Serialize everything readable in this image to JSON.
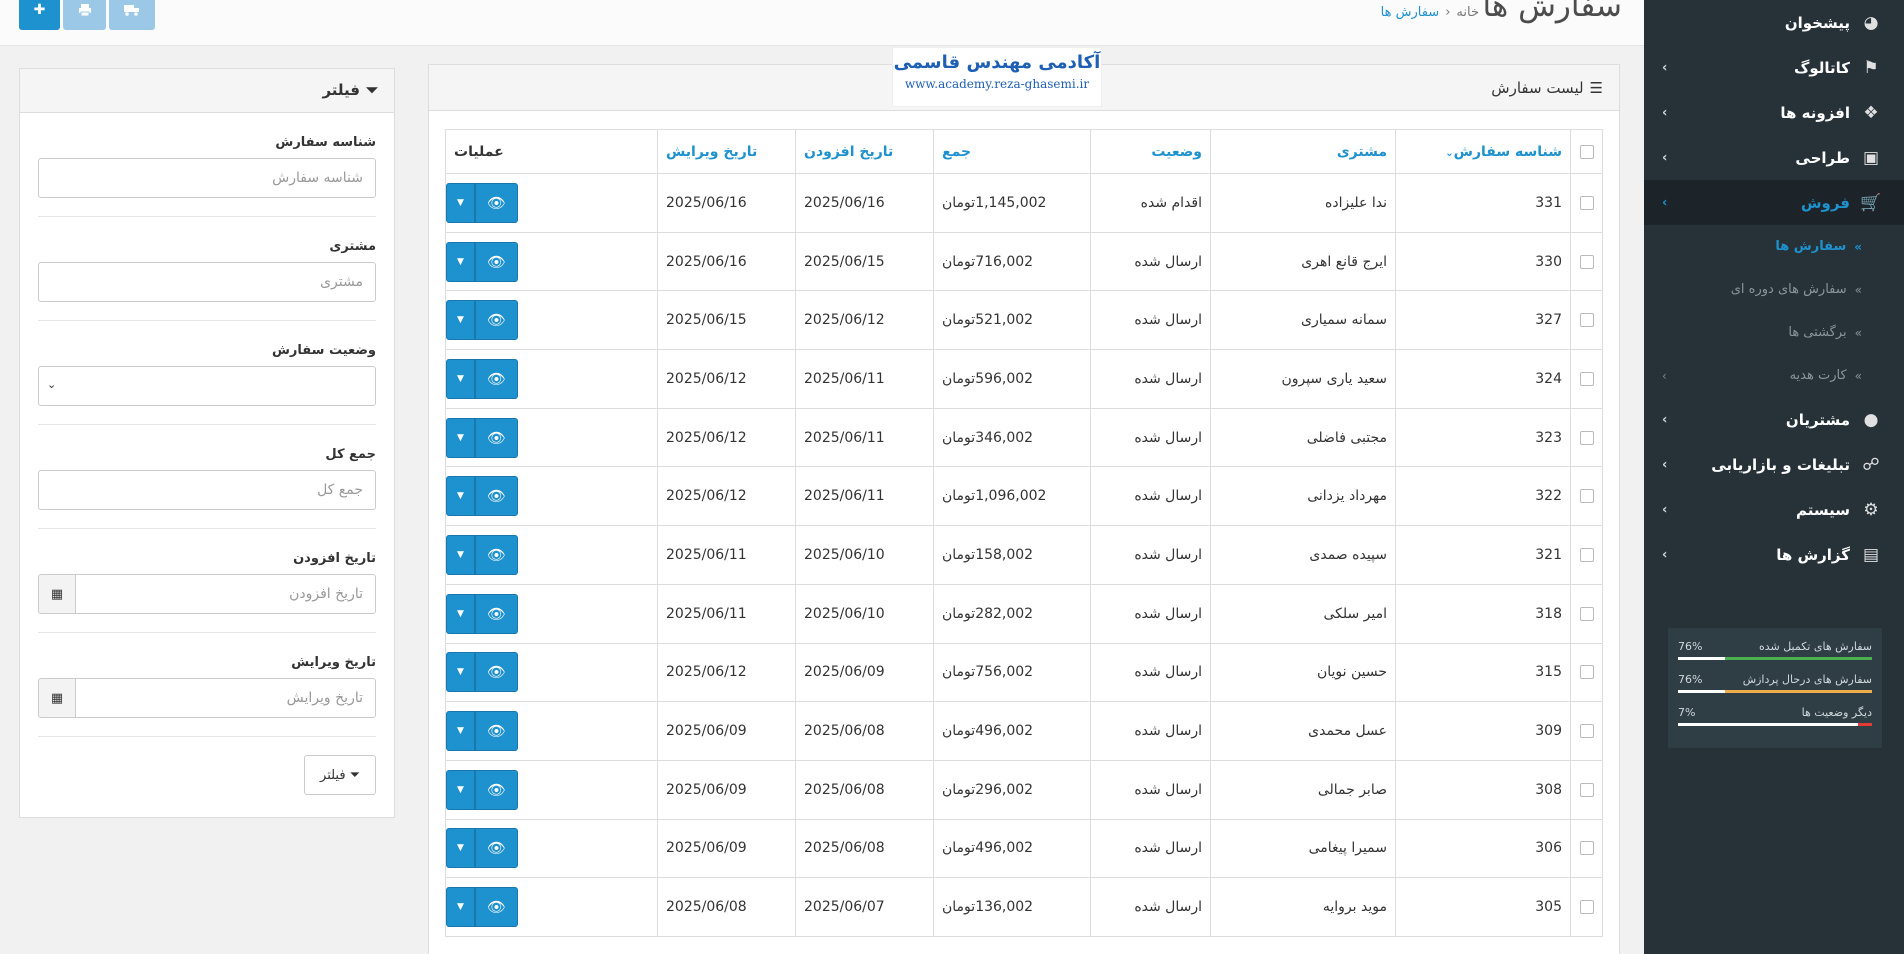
{
  "header": {
    "title": "سفارش ها",
    "breadcrumb": [
      "خانه",
      "سفارش ها"
    ],
    "breadcrumb_sep": "‹"
  },
  "sidebar": {
    "items": [
      {
        "label": "پیشخوان",
        "icon": "dashboard-icon",
        "has_children": false
      },
      {
        "label": "کاتالوگ",
        "icon": "tags-icon",
        "has_children": true
      },
      {
        "label": "افزونه ها",
        "icon": "puzzle-icon",
        "has_children": true
      },
      {
        "label": "طراحی",
        "icon": "desktop-icon",
        "has_children": true
      },
      {
        "label": "فروش",
        "icon": "shopping-cart-icon",
        "has_children": true,
        "active": true
      },
      {
        "label": "مشتریان",
        "icon": "user-icon",
        "has_children": true
      },
      {
        "label": "تبلیغات و بازاریابی",
        "icon": "share-icon",
        "has_children": true
      },
      {
        "label": "سیستم",
        "icon": "cog-icon",
        "has_children": true
      },
      {
        "label": "گزارش ها",
        "icon": "bar-chart-icon",
        "has_children": true
      }
    ],
    "sales_subitems": [
      {
        "label": "سفارش ها",
        "active": true
      },
      {
        "label": "سفارش های دوره ای"
      },
      {
        "label": "برگشتی ها"
      },
      {
        "label": "کارت هدیه",
        "has_children": true
      }
    ],
    "stats": [
      {
        "label": "سفارش های تکمیل شده",
        "percent": "76%",
        "value": 76,
        "color": "#4caf50"
      },
      {
        "label": "سفارش های درحال پردازش",
        "percent": "76%",
        "value": 76,
        "color": "#f0ad4e"
      },
      {
        "label": "دیگر وضعیت ها",
        "percent": "7%",
        "value": 7,
        "color": "#e53935"
      }
    ]
  },
  "list": {
    "title": "لیست سفارش",
    "watermark_title": "آکادمی مهندس قاسمی",
    "watermark_url": "www.academy.reza-ghasemi.ir",
    "columns": {
      "id": "شناسه سفارش",
      "customer": "مشتری",
      "status": "وضعیت",
      "total": "جمع",
      "date_added": "تاریخ افزودن",
      "date_modified": "تاریخ ویرایش",
      "actions": "عملیات"
    },
    "rows": [
      {
        "id": "331",
        "customer": "ندا علیزاده",
        "status": "اقدام شده",
        "total": "1,145,002تومان",
        "date_added": "2025/06/16",
        "date_modified": "2025/06/16"
      },
      {
        "id": "330",
        "customer": "ایرج قانع اهری",
        "status": "ارسال شده",
        "total": "716,002تومان",
        "date_added": "2025/06/15",
        "date_modified": "2025/06/16"
      },
      {
        "id": "327",
        "customer": "سمانه سمیاری",
        "status": "ارسال شده",
        "total": "521,002تومان",
        "date_added": "2025/06/12",
        "date_modified": "2025/06/15"
      },
      {
        "id": "324",
        "customer": "سعید یاری سپرون",
        "status": "ارسال شده",
        "total": "596,002تومان",
        "date_added": "2025/06/11",
        "date_modified": "2025/06/12"
      },
      {
        "id": "323",
        "customer": "مجتبی فاضلی",
        "status": "ارسال شده",
        "total": "346,002تومان",
        "date_added": "2025/06/11",
        "date_modified": "2025/06/12"
      },
      {
        "id": "322",
        "customer": "مهرداد یزدانی",
        "status": "ارسال شده",
        "total": "1,096,002تومان",
        "date_added": "2025/06/11",
        "date_modified": "2025/06/12"
      },
      {
        "id": "321",
        "customer": "سپیده صمدی",
        "status": "ارسال شده",
        "total": "158,002تومان",
        "date_added": "2025/06/10",
        "date_modified": "2025/06/11"
      },
      {
        "id": "318",
        "customer": "امیر سلکی",
        "status": "ارسال شده",
        "total": "282,002تومان",
        "date_added": "2025/06/10",
        "date_modified": "2025/06/11"
      },
      {
        "id": "315",
        "customer": "حسین نویان",
        "status": "ارسال شده",
        "total": "756,002تومان",
        "date_added": "2025/06/09",
        "date_modified": "2025/06/12"
      },
      {
        "id": "309",
        "customer": "عسل محمدی",
        "status": "ارسال شده",
        "total": "496,002تومان",
        "date_added": "2025/06/08",
        "date_modified": "2025/06/09"
      },
      {
        "id": "308",
        "customer": "صابر جمالی",
        "status": "ارسال شده",
        "total": "296,002تومان",
        "date_added": "2025/06/08",
        "date_modified": "2025/06/09"
      },
      {
        "id": "306",
        "customer": "سمیرا پیغامی",
        "status": "ارسال شده",
        "total": "496,002تومان",
        "date_added": "2025/06/08",
        "date_modified": "2025/06/09"
      },
      {
        "id": "305",
        "customer": "موید بروایه",
        "status": "ارسال شده",
        "total": "136,002تومان",
        "date_added": "2025/06/07",
        "date_modified": "2025/06/08"
      }
    ]
  },
  "filter": {
    "title": "فیلتر",
    "fields": {
      "order_id": {
        "label": "شناسه سفارش",
        "placeholder": "شناسه سفارش"
      },
      "customer": {
        "label": "مشتری",
        "placeholder": "مشتری"
      },
      "status": {
        "label": "وضعیت سفارش",
        "value": ""
      },
      "total": {
        "label": "جمع کل",
        "placeholder": "جمع کل"
      },
      "date_added": {
        "label": "تاریخ افزودن",
        "placeholder": "تاریخ افزودن"
      },
      "date_modified": {
        "label": "تاریخ ویرایش",
        "placeholder": "تاریخ ویرایش"
      }
    },
    "button_label": "فیلتر"
  },
  "colors": {
    "accent": "#1e91cf",
    "sidebar_bg": "#263238",
    "sidebar_active_bg": "#1c2429"
  }
}
